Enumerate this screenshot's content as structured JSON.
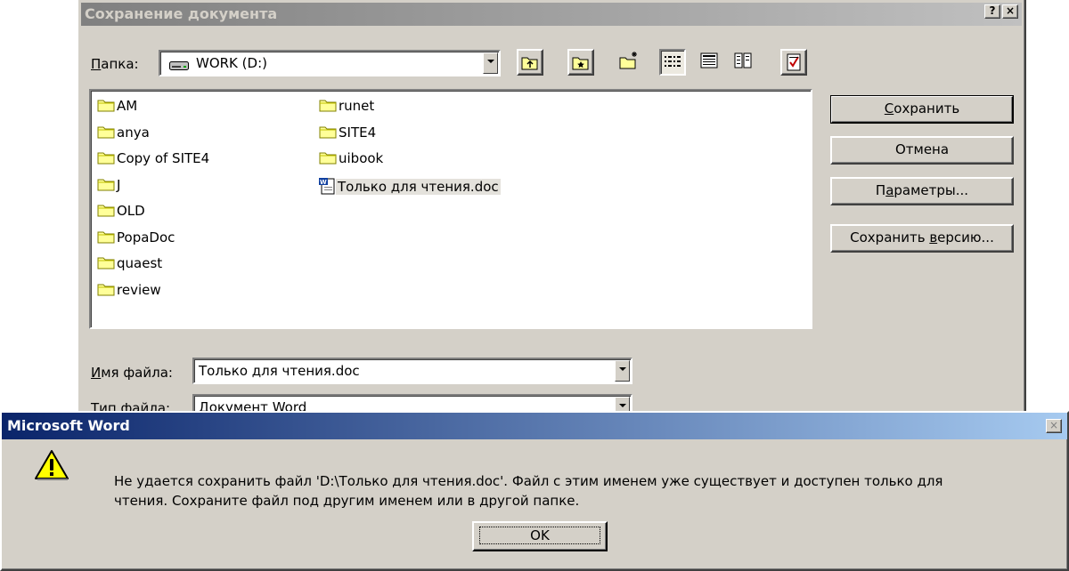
{
  "save_dialog": {
    "title": "Сохранение документа",
    "help_btn": "?",
    "close_btn": "×",
    "folder_label_ul": "П",
    "folder_label_rest": "апка:",
    "folder_value": "WORK (D:)",
    "files_col1": [
      "AM",
      "anya",
      "Copy of SITE4",
      "J",
      "OLD",
      "PopaDoc",
      "quaest",
      "review"
    ],
    "files_col2": [
      "runet",
      "SITE4",
      "uibook"
    ],
    "doc_file": "Только для чтения.doc",
    "buttons": {
      "save_ul": "С",
      "save_rest": "охранить",
      "cancel": "Отмена",
      "params_pre": "П",
      "params_ul": "а",
      "params_rest": "раметры...",
      "version_pre": "Сохранить ",
      "version_ul": "в",
      "version_rest": "ерсию..."
    },
    "filename_label_ul": "И",
    "filename_label_rest": "мя файла:",
    "filename_value": "Только для чтения.doc",
    "filetype_label": "Тип файла:",
    "filetype_value": "Документ Word"
  },
  "alert": {
    "title": "Microsoft Word",
    "close_btn": "×",
    "message_line1": "Не удается сохранить файл 'D:\\Только для чтения.doc'. Файл с этим именем уже существует и доступен только для",
    "message_line2": "чтения. Сохраните файл под другим именем или в другой папке.",
    "ok": "OK"
  },
  "colors": {
    "active_title_start": "#0a246a",
    "active_title_end": "#a6caf0",
    "inactive_title_start": "#808080",
    "inactive_title_end": "#c0c0c0",
    "face": "#d4d0c8"
  }
}
